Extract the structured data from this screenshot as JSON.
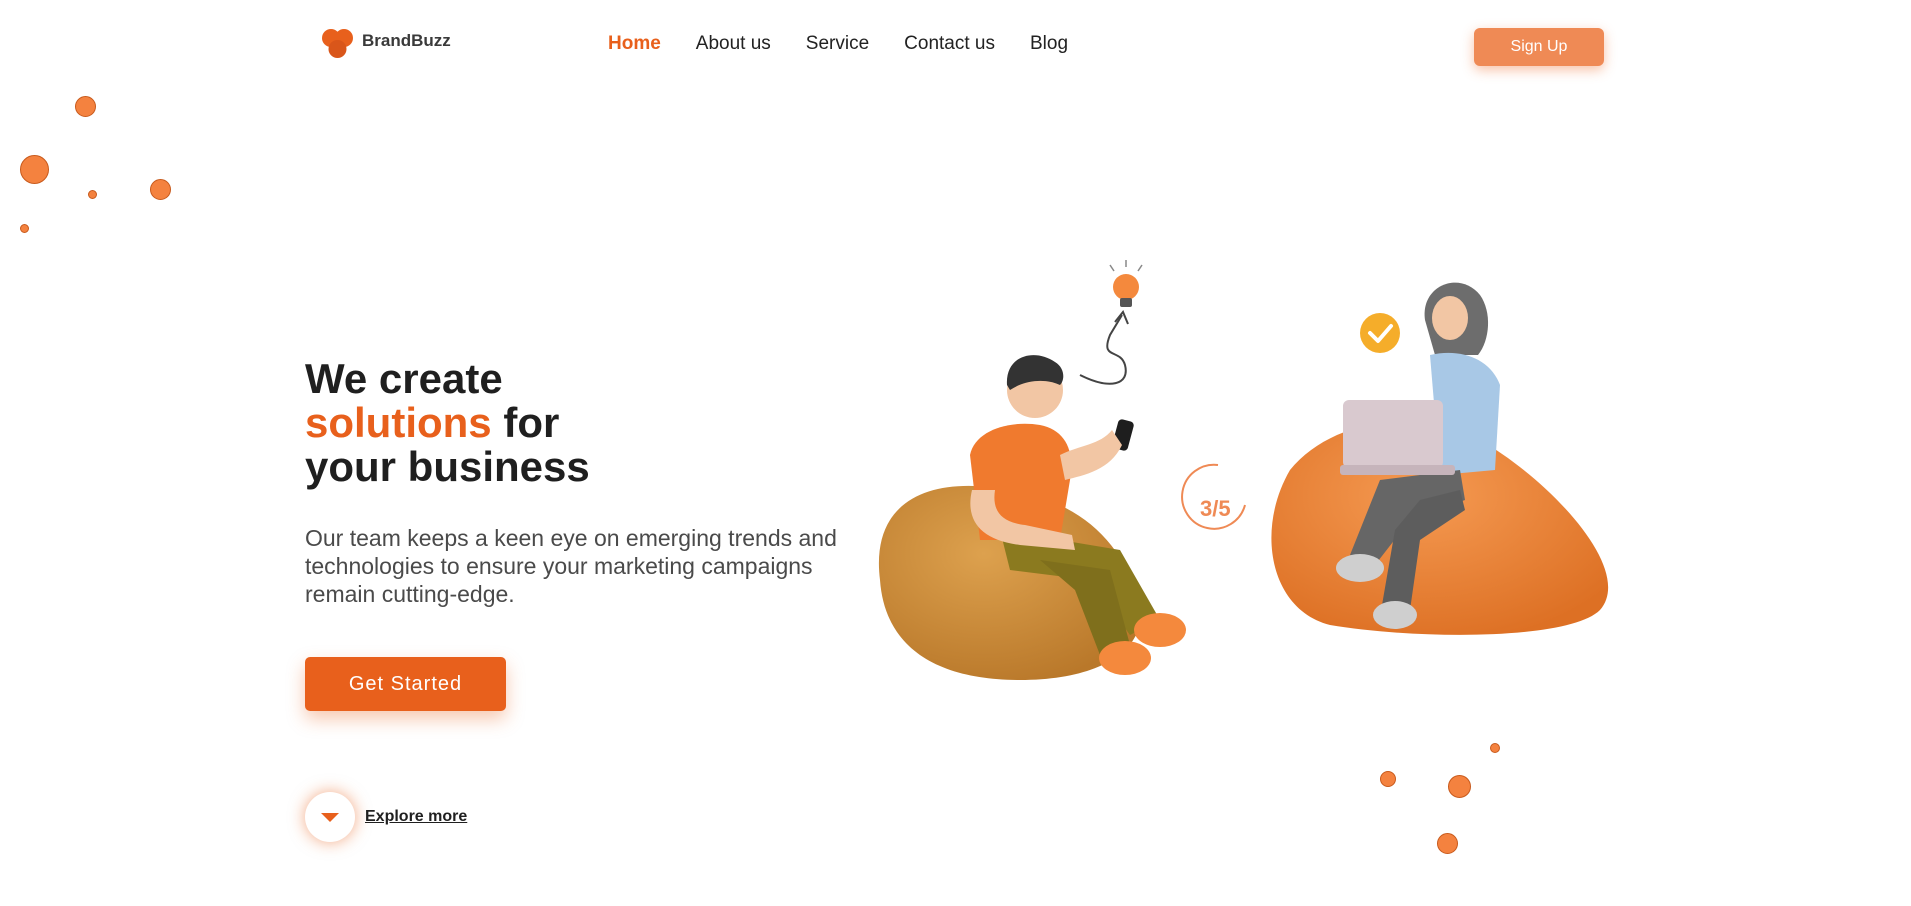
{
  "brand": {
    "name": "BrandBuzz",
    "logo_icon": "heart-cluster-logo",
    "accent_color": "#e8601c",
    "light_accent_color": "#ef8a55"
  },
  "nav": {
    "items": [
      {
        "label": "Home",
        "active": true
      },
      {
        "label": "About us",
        "active": false
      },
      {
        "label": "Service",
        "active": false
      },
      {
        "label": "Contact us",
        "active": false
      },
      {
        "label": "Blog",
        "active": false
      }
    ],
    "signup_label": "Sign Up"
  },
  "hero": {
    "headline_line1": "We create",
    "headline_accent": "solutions",
    "headline_line2_rest": " for",
    "headline_line3": "your business",
    "description": "Our team keeps a keen eye on emerging trends and technologies to ensure your marketing campaigns remain cutting-edge.",
    "cta_label": "Get Started",
    "explore_label": "Explore more",
    "explore_icon": "caret-down-icon"
  },
  "illustration": {
    "progress_text": "3/5",
    "icons": [
      "lightbulb-icon",
      "checkmark-badge-icon",
      "arrow-up-icon"
    ]
  }
}
